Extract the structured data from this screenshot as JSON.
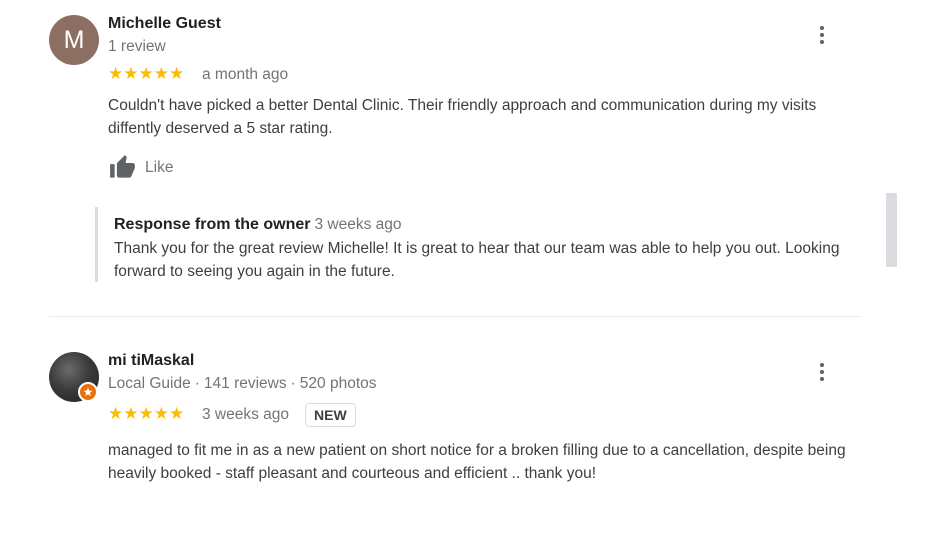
{
  "reviews": [
    {
      "avatar_letter": "M",
      "avatar_color": "#8d6e63",
      "name": "Michelle Guest",
      "meta": "1 review",
      "stars": "★★★★★",
      "rating": 5,
      "date": "a month ago",
      "text": "Couldn't have picked a better Dental Clinic. Their friendly approach and communication during my visits diffently deserved a 5 star rating.",
      "like_label": "Like",
      "owner_response": {
        "title": "Response from the owner",
        "date": "3 weeks ago",
        "text": "Thank you for the great review Michelle! It is great to hear that our team was able to help you out. Looking forward to seeing you again in the future."
      }
    },
    {
      "name": "mi tiMaskal",
      "meta_role": "Local Guide",
      "meta_reviews": "141 reviews",
      "meta_photos": "520 photos",
      "meta_separator": "·",
      "stars": "★★★★★",
      "rating": 5,
      "date": "3 weeks ago",
      "new_badge": "NEW",
      "text": "managed to fit me in as a new patient on short notice for a broken filling due to a cancellation, despite being heavily booked - staff pleasant and courteous and efficient .. thank you!",
      "badge_color": "#e8710a"
    }
  ],
  "icons": {
    "more": "more-vert-icon",
    "like": "thumb-up-icon",
    "local_guide": "local-guide-star-icon"
  },
  "colors": {
    "star": "#fbbc04",
    "secondary_text": "#70757a",
    "divider": "#e8eaed"
  }
}
